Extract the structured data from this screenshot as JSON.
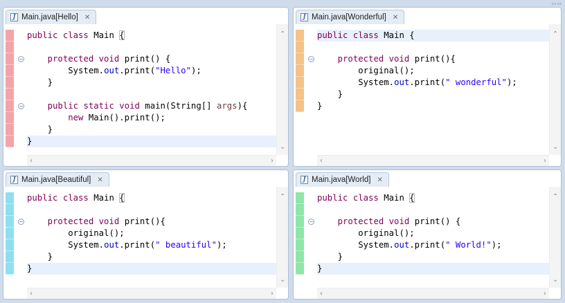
{
  "layout_controls": "▭▭",
  "panes": [
    {
      "tab": "Main.java[Hello]",
      "ruler_color": "#f4a4a8",
      "lines": [
        [
          {
            "t": "public class ",
            "c": "kw"
          },
          {
            "t": "Main "
          },
          {
            "t": "{",
            "c": "box"
          }
        ],
        [
          {
            "t": ""
          }
        ],
        [
          {
            "t": "    "
          },
          {
            "t": "protected void ",
            "c": "kw"
          },
          {
            "t": "print() {"
          }
        ],
        [
          {
            "t": "        System."
          },
          {
            "t": "out",
            "c": "fld"
          },
          {
            "t": ".print("
          },
          {
            "t": "\"Hello\"",
            "c": "str"
          },
          {
            "t": ");"
          }
        ],
        [
          {
            "t": "    }"
          }
        ],
        [
          {
            "t": ""
          }
        ],
        [
          {
            "t": "    "
          },
          {
            "t": "public static void ",
            "c": "kw"
          },
          {
            "t": "main(String[] "
          },
          {
            "t": "args",
            "c": "pm"
          },
          {
            "t": "){"
          }
        ],
        [
          {
            "t": "        "
          },
          {
            "t": "new ",
            "c": "kw"
          },
          {
            "t": "Main().print();"
          }
        ],
        [
          {
            "t": "    }"
          }
        ],
        [
          {
            "t": "}"
          }
        ]
      ],
      "fold_lines": [
        2,
        6
      ],
      "current_line": 9
    },
    {
      "tab": "Main.java[Wonderful]",
      "ruler_color": "#f5c287",
      "lines": [
        [
          {
            "t": "public class ",
            "c": "kw"
          },
          {
            "t": "Main {"
          }
        ],
        [
          {
            "t": ""
          }
        ],
        [
          {
            "t": "    "
          },
          {
            "t": "protected void ",
            "c": "kw"
          },
          {
            "t": "print(){"
          }
        ],
        [
          {
            "t": "        original();"
          }
        ],
        [
          {
            "t": "        System."
          },
          {
            "t": "out",
            "c": "fld"
          },
          {
            "t": ".print("
          },
          {
            "t": "\" wonderful\"",
            "c": "str"
          },
          {
            "t": ");"
          }
        ],
        [
          {
            "t": "    }"
          }
        ],
        [
          {
            "t": "}"
          }
        ]
      ],
      "fold_lines": [
        2
      ],
      "current_line": 0
    },
    {
      "tab": "Main.java[Beautiful]",
      "ruler_color": "#8ee0ef",
      "lines": [
        [
          {
            "t": "public class ",
            "c": "kw"
          },
          {
            "t": "Main "
          },
          {
            "t": "{",
            "c": "box"
          }
        ],
        [
          {
            "t": ""
          }
        ],
        [
          {
            "t": "    "
          },
          {
            "t": "protected void ",
            "c": "kw"
          },
          {
            "t": "print(){"
          }
        ],
        [
          {
            "t": "        original();"
          }
        ],
        [
          {
            "t": "        System."
          },
          {
            "t": "out",
            "c": "fld"
          },
          {
            "t": ".print("
          },
          {
            "t": "\" beautiful\"",
            "c": "str"
          },
          {
            "t": ");"
          }
        ],
        [
          {
            "t": "    }"
          }
        ],
        [
          {
            "t": "}"
          }
        ]
      ],
      "fold_lines": [
        2
      ],
      "current_line": 6
    },
    {
      "tab": "Main.java[World]",
      "ruler_color": "#8ee6a8",
      "lines": [
        [
          {
            "t": "public class ",
            "c": "kw"
          },
          {
            "t": "Main "
          },
          {
            "t": "{",
            "c": "box"
          }
        ],
        [
          {
            "t": ""
          }
        ],
        [
          {
            "t": "    "
          },
          {
            "t": "protected void ",
            "c": "kw"
          },
          {
            "t": "print() {"
          }
        ],
        [
          {
            "t": "        original();"
          }
        ],
        [
          {
            "t": "        System."
          },
          {
            "t": "out",
            "c": "fld"
          },
          {
            "t": ".print("
          },
          {
            "t": "\" World!\"",
            "c": "str"
          },
          {
            "t": ");"
          }
        ],
        [
          {
            "t": "    }"
          }
        ],
        [
          {
            "t": "}"
          }
        ]
      ],
      "fold_lines": [
        2
      ],
      "current_line": 6
    }
  ]
}
